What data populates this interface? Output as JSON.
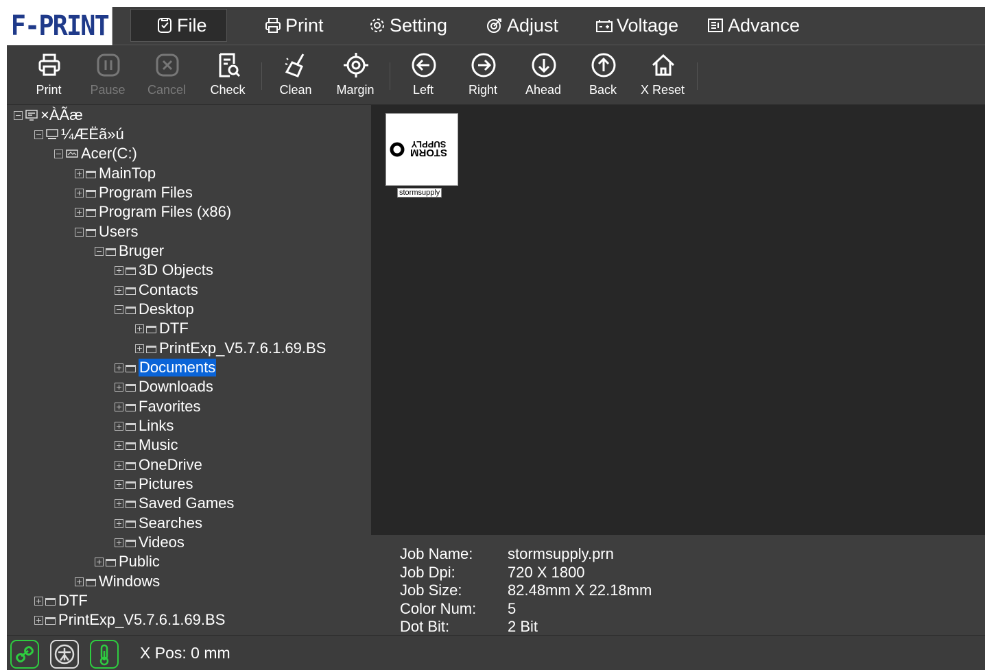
{
  "app": {
    "logo": "F-PRINT"
  },
  "menu": {
    "file": "File",
    "print": "Print",
    "setting": "Setting",
    "adjust": "Adjust",
    "voltage": "Voltage",
    "advance": "Advance"
  },
  "toolbar": {
    "print": "Print",
    "pause": "Pause",
    "cancel": "Cancel",
    "check": "Check",
    "clean": "Clean",
    "margin": "Margin",
    "left": "Left",
    "right": "Right",
    "ahead": "Ahead",
    "back": "Back",
    "xreset": "X Reset"
  },
  "tree": [
    {
      "label": "×ÀÃæ",
      "expander": "minus",
      "icon": "desktop-icon"
    },
    {
      "label": "¼ÆËã»ú",
      "expander": "minus",
      "icon": "computer-icon"
    },
    {
      "label": "Acer(C:)",
      "expander": "minus",
      "icon": "drive-icon"
    },
    {
      "label": "MainTop",
      "expander": "plus",
      "icon": "folder-icon"
    },
    {
      "label": "Program Files",
      "expander": "plus",
      "icon": "folder-icon"
    },
    {
      "label": "Program Files (x86)",
      "expander": "plus",
      "icon": "folder-icon"
    },
    {
      "label": "Users",
      "expander": "minus",
      "icon": "folder-icon"
    },
    {
      "label": "Bruger",
      "expander": "minus",
      "icon": "folder-icon"
    },
    {
      "label": "3D Objects",
      "expander": "plus",
      "icon": "folder-icon"
    },
    {
      "label": "Contacts",
      "expander": "plus",
      "icon": "folder-icon"
    },
    {
      "label": "Desktop",
      "expander": "minus",
      "icon": "folder-icon"
    },
    {
      "label": "DTF",
      "expander": "plus",
      "icon": "folder-icon"
    },
    {
      "label": "PrintExp_V5.7.6.1.69.BS",
      "expander": "plus",
      "icon": "folder-icon"
    },
    {
      "label": "Documents",
      "expander": "plus",
      "icon": "folder-icon",
      "selected": true
    },
    {
      "label": "Downloads",
      "expander": "plus",
      "icon": "folder-icon"
    },
    {
      "label": "Favorites",
      "expander": "plus",
      "icon": "folder-icon"
    },
    {
      "label": "Links",
      "expander": "plus",
      "icon": "folder-icon"
    },
    {
      "label": "Music",
      "expander": "plus",
      "icon": "folder-icon"
    },
    {
      "label": "OneDrive",
      "expander": "plus",
      "icon": "folder-icon"
    },
    {
      "label": "Pictures",
      "expander": "plus",
      "icon": "folder-icon"
    },
    {
      "label": "Saved Games",
      "expander": "plus",
      "icon": "folder-icon"
    },
    {
      "label": "Searches",
      "expander": "plus",
      "icon": "folder-icon"
    },
    {
      "label": "Videos",
      "expander": "plus",
      "icon": "folder-icon"
    },
    {
      "label": "Public",
      "expander": "plus",
      "icon": "folder-icon"
    },
    {
      "label": "Windows",
      "expander": "plus",
      "icon": "folder-icon"
    },
    {
      "label": "DTF",
      "expander": "plus",
      "icon": "folder-icon"
    },
    {
      "label": "PrintExp_V5.7.6.1.69.BS",
      "expander": "plus",
      "icon": "folder-icon"
    }
  ],
  "preview": {
    "thumb_label": "stormsupply",
    "thumb_text_top": "SUPPLY",
    "thumb_text_bottom": "STORM"
  },
  "job": {
    "name_label": "Job Name:",
    "name_value": "stormsupply.prn",
    "dpi_label": "Job Dpi:",
    "dpi_value": "720 X 1800",
    "size_label": "Job Size:",
    "size_value": "82.48mm X 22.18mm",
    "color_label": "Color Num:",
    "color_value": "5",
    "dot_label": "Dot Bit:",
    "dot_value": "2 Bit"
  },
  "status": {
    "xpos": "X Pos: 0 mm",
    "ok_color": "#2ecc40"
  }
}
